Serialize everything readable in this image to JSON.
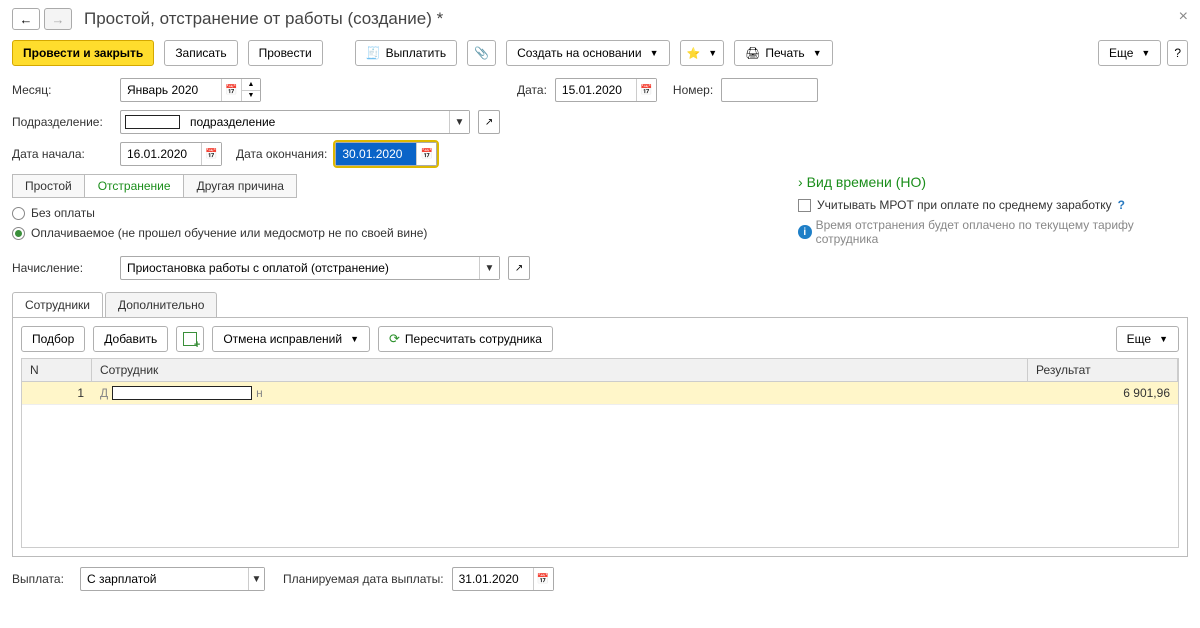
{
  "header": {
    "title": "Простой, отстранение от работы (создание) *"
  },
  "toolbar": {
    "submit_close": "Провести и закрыть",
    "save": "Записать",
    "submit": "Провести",
    "pay": "Выплатить",
    "create_based": "Создать на основании",
    "print": "Печать",
    "more": "Еще",
    "help": "?"
  },
  "form": {
    "month_label": "Месяц:",
    "month_value": "Январь 2020",
    "date_label": "Дата:",
    "date_value": "15.01.2020",
    "number_label": "Номер:",
    "number_value": "",
    "division_label": "Подразделение:",
    "division_value": "подразделение",
    "start_label": "Дата начала:",
    "start_value": "16.01.2020",
    "end_label": "Дата окончания:",
    "end_value": "30.01.2020"
  },
  "tabs": {
    "simple": "Простой",
    "suspension": "Отстранение",
    "other": "Другая причина"
  },
  "radios": {
    "no_pay": "Без оплаты",
    "paid": "Оплачиваемое (не прошел обучение или медосмотр не по своей вине)"
  },
  "right_panel": {
    "time_type": "Вид времени (НО)",
    "mrot_checkbox": "Учитывать МРОТ при оплате по среднему заработку",
    "info": "Время отстранения будет оплачено по текущему тарифу сотрудника"
  },
  "accrual": {
    "label": "Начисление:",
    "value": "Приостановка работы с оплатой (отстранение)"
  },
  "emp_tabs": {
    "employees": "Сотрудники",
    "additional": "Дополнительно"
  },
  "panel_toolbar": {
    "pick": "Подбор",
    "add": "Добавить",
    "cancel_fix": "Отмена исправлений",
    "recalc": "Пересчитать сотрудника",
    "more": "Еще"
  },
  "table": {
    "col_n": "N",
    "col_emp": "Сотрудник",
    "col_res": "Результат",
    "rows": [
      {
        "n": "1",
        "emp": "",
        "res": "6 901,96"
      }
    ]
  },
  "footer": {
    "payout_label": "Выплата:",
    "payout_value": "С зарплатой",
    "planned_label": "Планируемая дата выплаты:",
    "planned_value": "31.01.2020"
  }
}
